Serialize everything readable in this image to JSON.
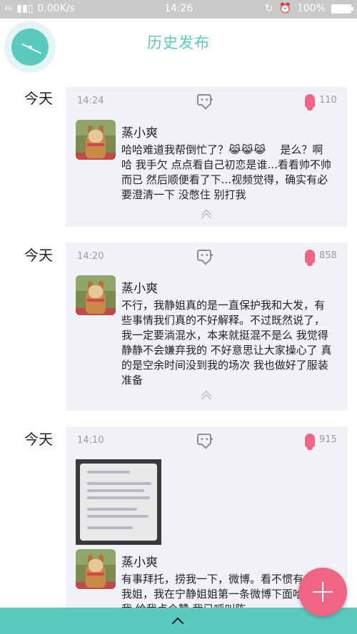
{
  "status_bar": {
    "signal_small": "4G",
    "signal_label": "4G",
    "speed": "0.00K/s",
    "time": "14:26",
    "battery": "100%"
  },
  "header": {
    "title": "历史发布"
  },
  "posts": [
    {
      "date": "今天",
      "time": "14:24",
      "likes": "110",
      "username": "蒸小爽",
      "text": "哈哈难道我帮倒忙了？😹😹😹　 是么？啊哈 我手欠 点点看自己初恋是谁...看看帅不帅而已 然后顺便看了下...视频觉得，确实有必要澄清一下 没憋住 别打我"
    },
    {
      "date": "今天",
      "time": "14:20",
      "likes": "858",
      "username": "蒸小爽",
      "text": "不行，我静姐真的是一直保护我和大发，有些事情我们真的不好解释。不过既然说了，我一定要淌混水，本来就挺混不是么 我觉得静静不会嫌弃我的 不好意思让大家操心了 真的是空余时间没到我的场次 我也做好了服装准备"
    },
    {
      "date": "今天",
      "time": "14:10",
      "likes": "915",
      "username": "蒸小爽",
      "text": "有事拜托，捞我一下，微博。看不惯有人黑我姐，我在宁静姐姐第一条微博下面哈哈 捞我 给我点个赞 我已呼叫陈"
    }
  ],
  "icons": {
    "clock": "clock-icon",
    "comment": "comment-icon",
    "like": "like-icon",
    "expand": "chevron-up-icon",
    "add": "plus-icon"
  },
  "colors": {
    "accent": "#5cc9bf",
    "like": "#f06583",
    "card": "#f1f2f7"
  }
}
